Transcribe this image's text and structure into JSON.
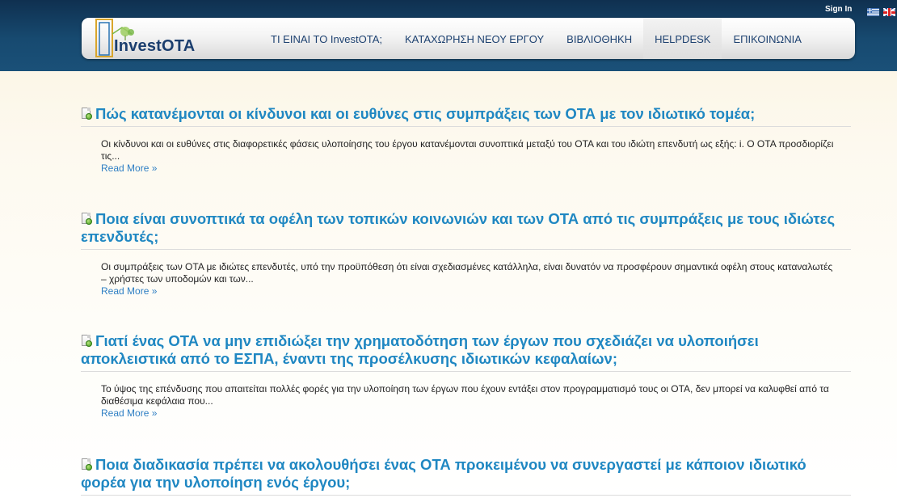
{
  "header": {
    "sign_in": "Sign In",
    "languages": [
      {
        "code": "el",
        "icon": "greek-flag-icon"
      },
      {
        "code": "en",
        "icon": "uk-flag-icon"
      }
    ],
    "logo": {
      "prefix": "Invest",
      "suffix": "OTA"
    },
    "nav": [
      {
        "label": "ΤΙ ΕΙΝΑΙ ΤΟ InvestOTA;",
        "active": false
      },
      {
        "label": "ΚΑΤΑΧΩΡΗΣΗ ΝΕΟΥ ΕΡΓΟΥ",
        "active": false
      },
      {
        "label": "ΒΙΒΛΙΟΘΗΚΗ",
        "active": false
      },
      {
        "label": "HELPDESK",
        "active": true
      },
      {
        "label": "ΕΠΙΚΟΙΝΩΝΙΑ",
        "active": false
      }
    ]
  },
  "articles": [
    {
      "title": "Πώς κατανέμονται οι κίνδυνοι και οι ευθύνες στις συμπράξεις των ΟΤΑ με τον ιδιωτικό τομέα;",
      "excerpt": "Οι κίνδυνοι και οι ευθύνες στις διαφορετικές φάσεις υλοποίησης του έργου κατανέμονται συνοπτικά μεταξύ του ΟΤΑ και του ιδιώτη επενδυτή ως εξής:  i. Ο ΟΤΑ  προσδιορίζει τις...",
      "read_more": "Read More »"
    },
    {
      "title": "Ποια είναι συνοπτικά τα οφέλη των τοπικών κοινωνιών και των ΟΤΑ από τις συμπράξεις με τους ιδιώτες επενδυτές;",
      "excerpt": "Οι συμπράξεις των ΟΤΑ με ιδιώτες επενδυτές, υπό την προϋπόθεση ότι είναι σχεδιασμένες κατάλληλα, είναι δυνατόν να προσφέρουν σημαντικά οφέλη στους καταναλωτές – χρήστες των υποδομών και των...",
      "read_more": "Read More »"
    },
    {
      "title": "Γιατί ένας ΟΤΑ να μην επιδιώξει την χρηματοδότηση των έργων που σχεδιάζει να υλοποιήσει αποκλειστικά από το ΕΣΠΑ, έναντι της προσέλκυσης ιδιωτικών κεφαλαίων;",
      "excerpt": "Το ύψος της επένδυσης που απαιτείται πολλές φορές για την υλοποίηση των έργων που έχουν εντάξει στον προγραμματισμό τους οι ΟΤΑ, δεν μπορεί να καλυφθεί από τα διαθέσιμα κεφάλαια που...",
      "read_more": "Read More »"
    },
    {
      "title": "Ποια διαδικασία πρέπει να ακολουθήσει ένας ΟΤΑ προκειμένου να συνεργαστεί με κάποιον ιδιωτικό φορέα για την υλοποίηση ενός έργου;",
      "excerpt": "",
      "read_more": ""
    }
  ]
}
